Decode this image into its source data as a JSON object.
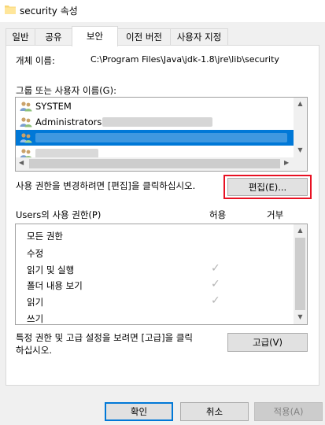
{
  "window": {
    "title": "security 속성"
  },
  "tabs": [
    {
      "label": "일반"
    },
    {
      "label": "공유"
    },
    {
      "label": "보안"
    },
    {
      "label": "이전 버전"
    },
    {
      "label": "사용자 지정"
    }
  ],
  "active_tab": "보안",
  "object": {
    "label": "개체 이름:",
    "value": "C:\\Program Files\\Java\\jdk-1.8\\jre\\lib\\security"
  },
  "groups": {
    "label": "그룹 또는 사용자 이름(G):",
    "items": [
      {
        "name": "SYSTEM"
      },
      {
        "name": "Administrators ("
      }
    ]
  },
  "change_hint": "사용 권한을 변경하려면 [편집]을 클릭하십시오.",
  "edit_button": "편집(E)...",
  "permissions": {
    "label": "Users의 사용 권한(P)",
    "allow_header": "허용",
    "deny_header": "거부",
    "rows": [
      {
        "name": "모든 권한",
        "allow": false
      },
      {
        "name": "수정",
        "allow": false
      },
      {
        "name": "읽기 및 실행",
        "allow": true
      },
      {
        "name": "폴더 내용 보기",
        "allow": true
      },
      {
        "name": "읽기",
        "allow": true
      },
      {
        "name": "쓰기",
        "allow": false
      }
    ]
  },
  "advanced": {
    "hint_line1": "특정 권한 및 고급 설정을 보려면 [고급]을 클릭",
    "hint_line2": "하십시오.",
    "button": "고급(V)"
  },
  "footer": {
    "ok": "확인",
    "cancel": "취소",
    "apply": "적용(A)"
  },
  "check_glyph": "✓",
  "colors": {
    "selection": "#0078d7",
    "highlight_border": "#e81123"
  }
}
